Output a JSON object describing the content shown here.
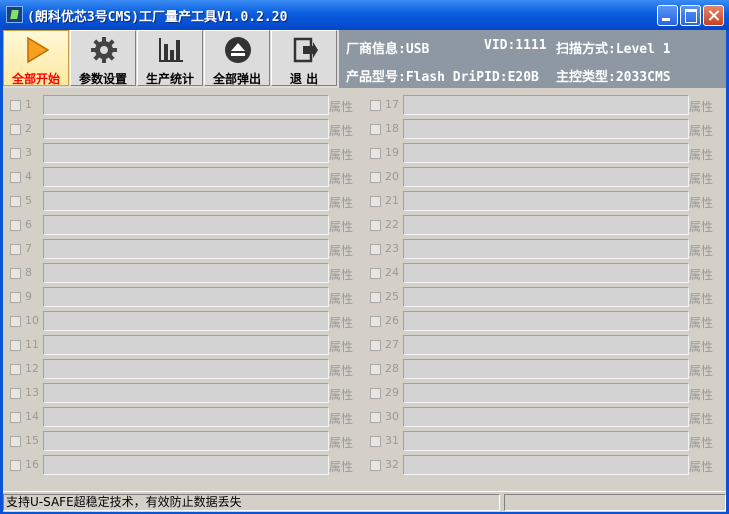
{
  "window": {
    "title": "(朗科优芯3号CMS)工厂量产工具V1.0.2.20"
  },
  "toolbar": {
    "buttons": [
      {
        "label": "全部开始",
        "icon": "play-icon"
      },
      {
        "label": "参数设置",
        "icon": "gear-icon"
      },
      {
        "label": "生产统计",
        "icon": "bar-chart-icon"
      },
      {
        "label": "全部弹出",
        "icon": "eject-icon"
      },
      {
        "label": "退 出",
        "icon": "exit-icon"
      }
    ]
  },
  "info": {
    "vendor_info": "厂商信息:USB",
    "vid": "VID:1111",
    "scan_mode": "扫描方式:Level 1",
    "product_model": "产品型号:Flash DriPID:E20B",
    "controller_type": "主控类型:2033CMS"
  },
  "ports": {
    "attr_label": "属性",
    "left": [
      "1",
      "2",
      "3",
      "4",
      "5",
      "6",
      "7",
      "8",
      "9",
      "10",
      "11",
      "12",
      "13",
      "14",
      "15",
      "16"
    ],
    "right": [
      "17",
      "18",
      "19",
      "20",
      "21",
      "22",
      "23",
      "24",
      "25",
      "26",
      "27",
      "28",
      "29",
      "30",
      "31",
      "32"
    ]
  },
  "status": {
    "text": "支持U-SAFE超稳定技术，有效防止数据丢失"
  },
  "colors": {
    "titlebar": "#0a5ddf",
    "info_panel": "#8d98a3",
    "active_label": "#ff0000"
  }
}
